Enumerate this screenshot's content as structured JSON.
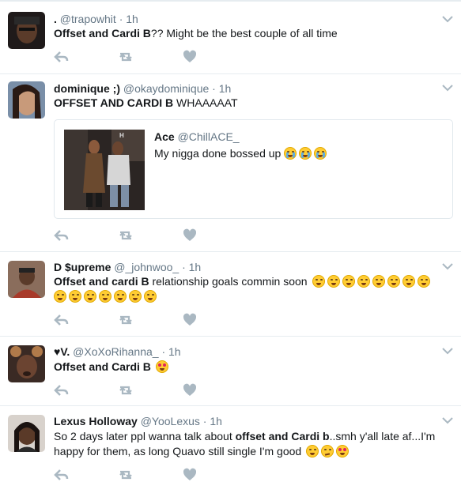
{
  "tweets": [
    {
      "name": ".",
      "handle": "@trapowhit",
      "dot": "·",
      "time": "1h",
      "text_bold": "Offset and Cardi B",
      "text_rest": "?? Might be the best couple of all time"
    },
    {
      "name": "dominique ;)",
      "handle": "@okaydominique",
      "dot": "·",
      "time": "1h",
      "text": "OFFSET AND CARDI B WHAAAAAT",
      "text_bold": "OFFSET AND CARDI B",
      "text_rest": " WHAAAAAT",
      "quote": {
        "name": "Ace",
        "handle": "@ChillACE_",
        "text": "My nigga done bossed up",
        "emoji": [
          "loudly-crying-face",
          "loudly-crying-face",
          "loudly-crying-face"
        ]
      }
    },
    {
      "name": "D $upreme",
      "handle": "@_johnwoo_",
      "dot": "·",
      "time": "1h",
      "text_bold": "Offset and cardi B",
      "text_rest": " relationship goals commin soon",
      "emoji_line1": [
        "face-with-tears-of-joy",
        "face-with-tears-of-joy",
        "face-with-tears-of-joy",
        "face-with-tears-of-joy",
        "face-with-tears-of-joy",
        "face-with-tears-of-joy",
        "face-with-tears-of-joy",
        "face-with-tears-of-joy"
      ],
      "emoji_line2": [
        "face-with-tears-of-joy",
        "face-with-tears-of-joy",
        "face-with-tears-of-joy",
        "face-with-tears-of-joy",
        "face-with-tears-of-joy",
        "face-with-tears-of-joy",
        "face-with-tears-of-joy"
      ]
    },
    {
      "name": "♥V.",
      "handle": "@XoXoRihanna_",
      "dot": "·",
      "time": "1h",
      "text_bold": "Offset and Cardi B",
      "emoji": [
        "smiling-face-with-heart-eyes"
      ]
    },
    {
      "name": "Lexus Holloway",
      "handle": "@YooLexus",
      "dot": "·",
      "time": "1h",
      "text_pre": "So 2 days later ppl wanna talk about ",
      "text_bold": "offset and Cardi b",
      "text_rest": "..smh y'all late af...I'm",
      "text_line2": "happy for them, as long Quavo still single I'm good",
      "emoji": [
        "smiling-face-with-smiling-eyes",
        "smirking-face",
        "smiling-face-with-heart-eyes"
      ]
    }
  ],
  "icons": {
    "reply": "reply-icon",
    "retweet": "retweet-icon",
    "like": "heart-icon",
    "menu": "chevron-down-icon"
  },
  "colors": {
    "text": "#14171a",
    "muted": "#657786",
    "icon": "#aab8c2",
    "border": "#e6ecf0"
  }
}
